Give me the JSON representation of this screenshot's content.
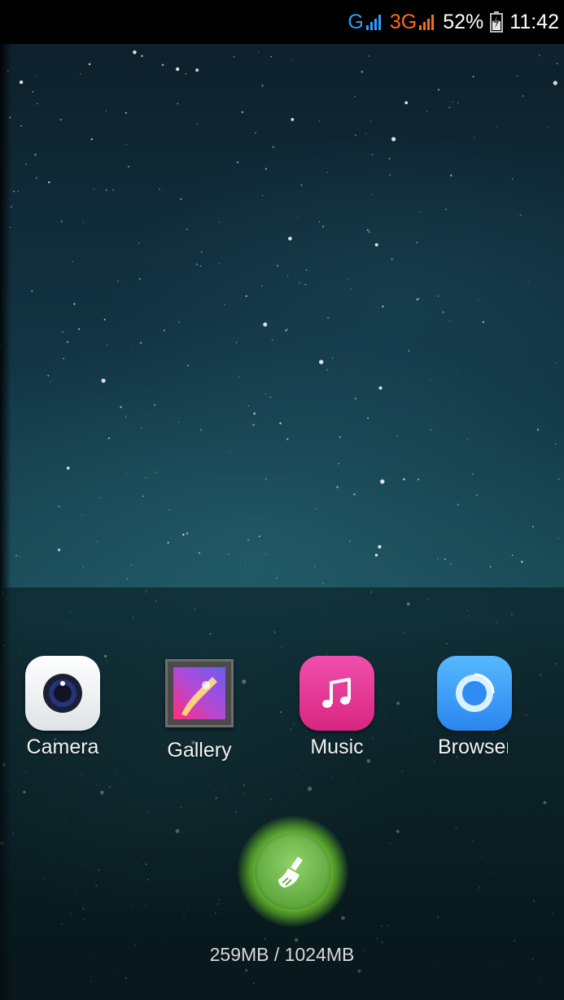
{
  "status_bar": {
    "network_g": "G",
    "network_3g": "3G",
    "battery_percent": "52%",
    "time": "11:42",
    "icons": [
      "signal-icon",
      "signal-icon",
      "battery-charging-icon"
    ],
    "colors": {
      "g": "#2f9cff",
      "3g": "#ff6a1a"
    }
  },
  "dock": {
    "apps": [
      {
        "label": "Camera",
        "icon": "camera-icon"
      },
      {
        "label": "Gallery",
        "icon": "gallery-icon"
      },
      {
        "label": "Music",
        "icon": "music-note-icon"
      },
      {
        "label": "Browser",
        "icon": "browser-icon"
      }
    ]
  },
  "memory": {
    "used": "259MB",
    "total": "1024MB",
    "text": "259MB / 1024MB",
    "clean_button_icon": "broom-icon",
    "accent": "#7ed957"
  }
}
